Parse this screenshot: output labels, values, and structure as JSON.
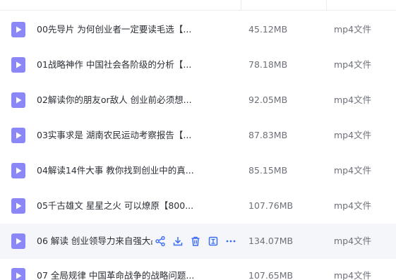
{
  "files": [
    {
      "name": "00先导片 为何创业者一定要读毛选【...",
      "size": "45.12MB",
      "type": "mp4文件",
      "icon": "video-file-icon"
    },
    {
      "name": "01战略神作 中国社会各阶级的分析【...",
      "size": "78.18MB",
      "type": "mp4文件",
      "icon": "video-file-icon"
    },
    {
      "name": "02解读你的朋友or敌人 创业前必须想...",
      "size": "92.05MB",
      "type": "mp4文件",
      "icon": "video-file-icon"
    },
    {
      "name": "03实事求是 湖南农民运动考察报告【...",
      "size": "87.83MB",
      "type": "mp4文件",
      "icon": "video-file-icon"
    },
    {
      "name": "04解读14件大事 教你找到创业中的真...",
      "size": "85.15MB",
      "type": "mp4文件",
      "icon": "video-file-icon"
    },
    {
      "name": "05千古雄文 星星之火 可以燎原【800...",
      "size": "107.76MB",
      "type": "mp4文件",
      "icon": "video-file-icon"
    },
    {
      "name": "06 解读 创业领导力来自强大战略【...",
      "size": "134.07MB",
      "type": "mp4文件",
      "icon": "video-file-icon"
    },
    {
      "name": "07 全局规律 中国革命战争的战略问题...",
      "size": "107.65MB",
      "type": "mp4文件",
      "icon": "video-file-icon"
    }
  ],
  "hovered_row_index": 6,
  "row_actions": [
    "share-icon",
    "download-icon",
    "delete-icon",
    "more-info-icon",
    "more-icon"
  ],
  "colors": {
    "icon_purple": "#8b87f6",
    "action_blue": "#3b6df2",
    "hover_bg": "#f5f6fa"
  }
}
